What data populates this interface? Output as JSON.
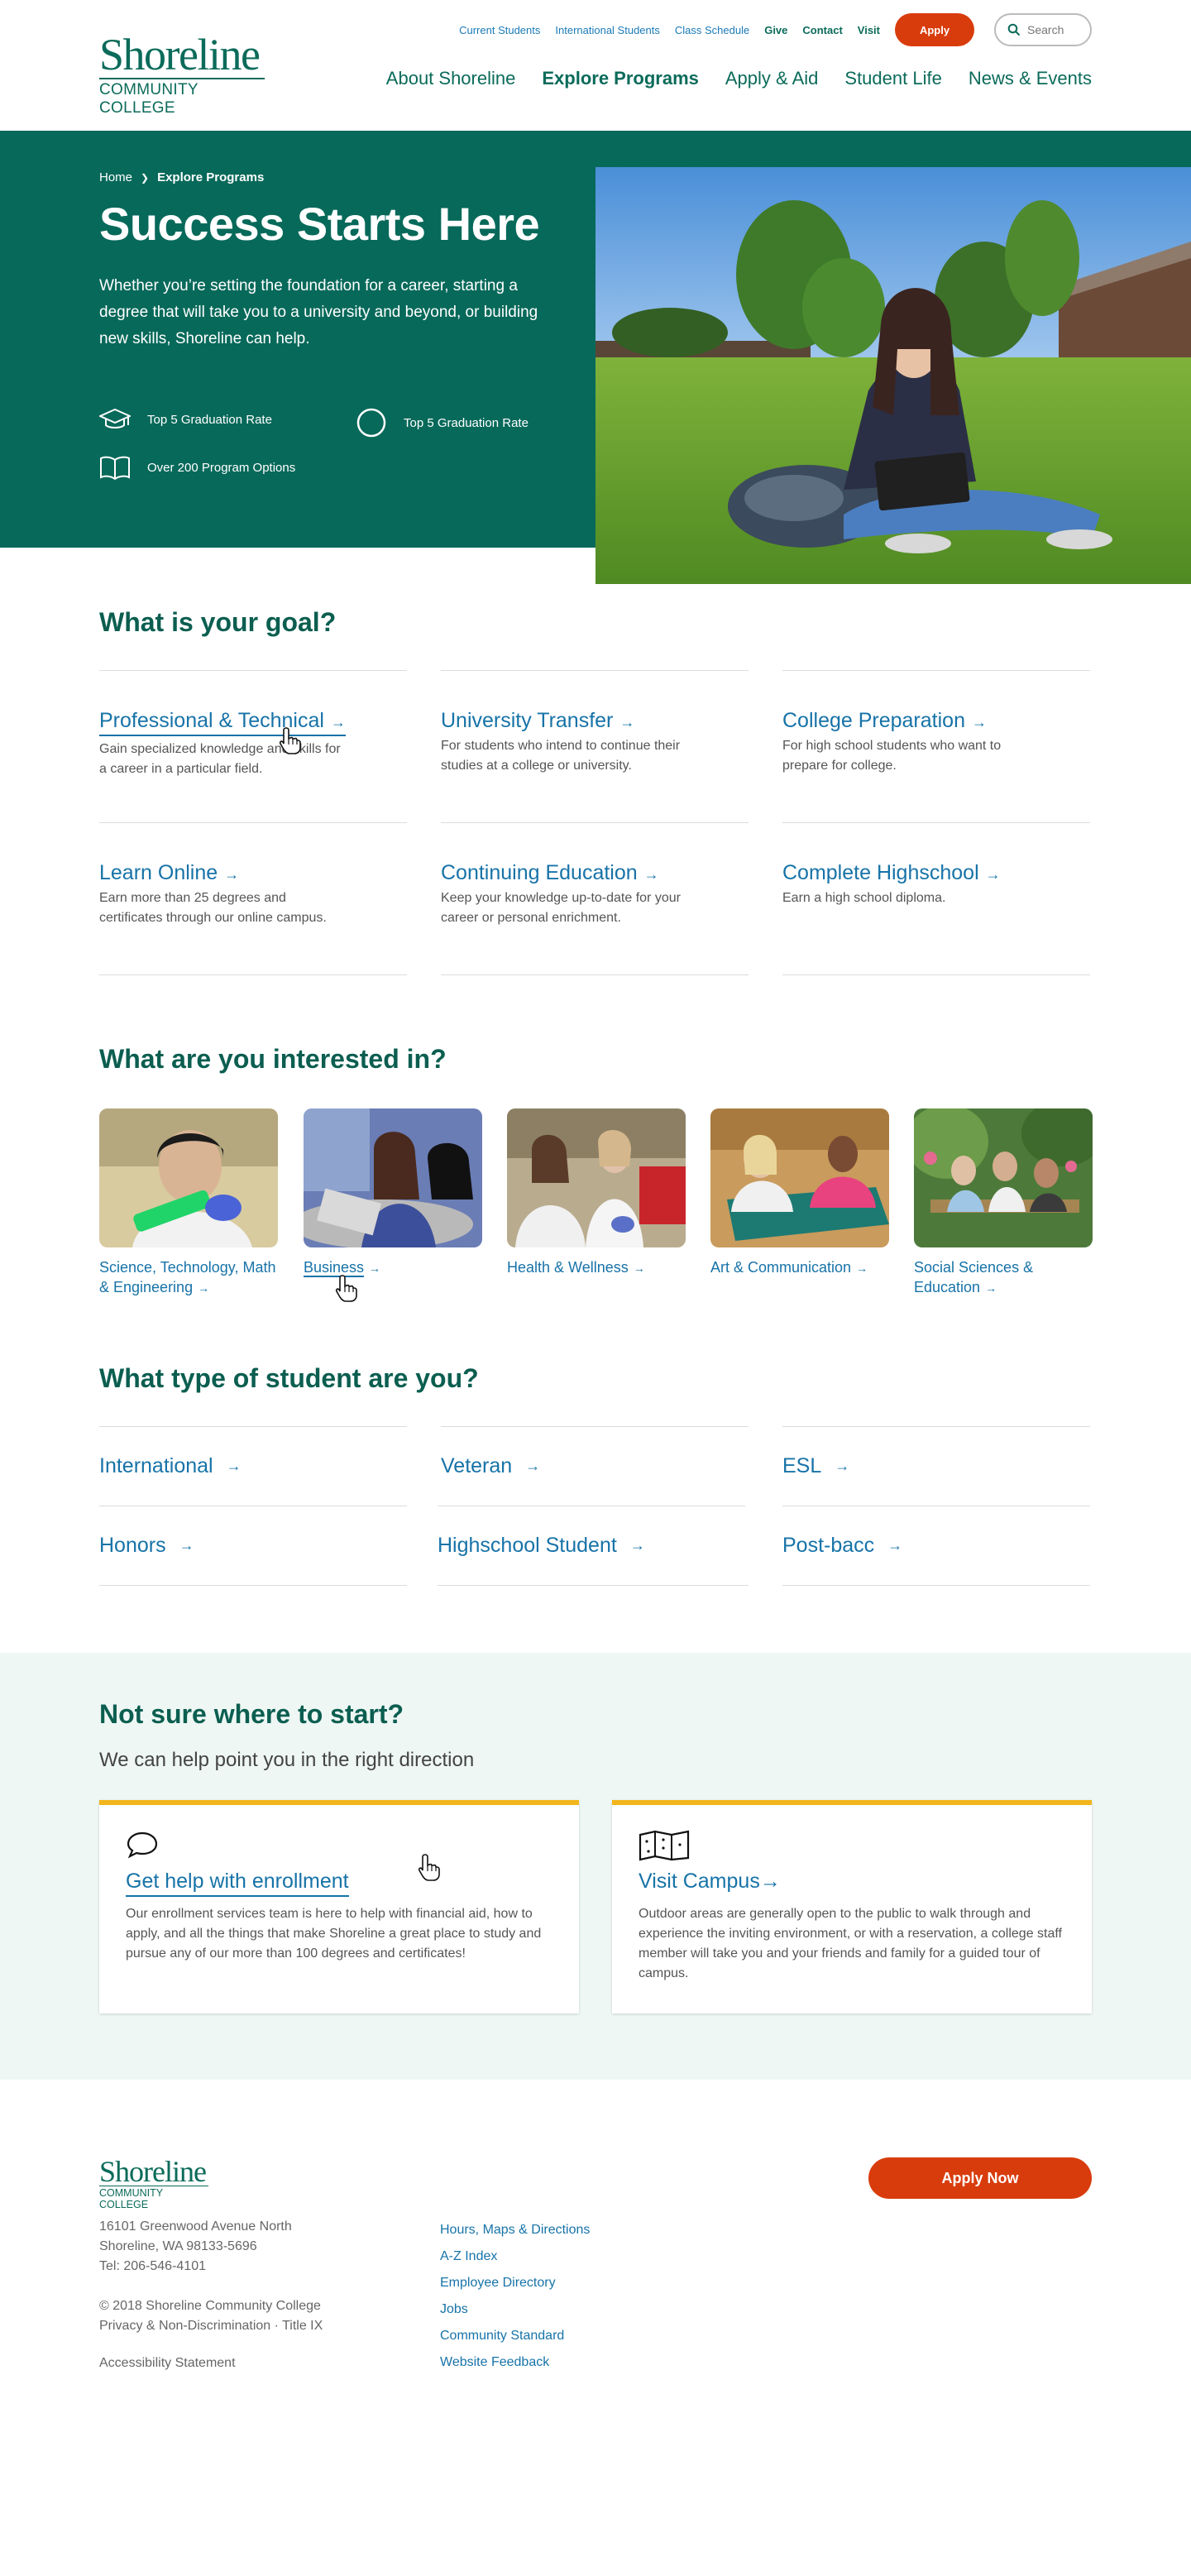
{
  "logo": {
    "name": "Shoreline",
    "subtitle": "COMMUNITY COLLEGE"
  },
  "utility_nav": {
    "links": [
      "Current Students",
      "International Students",
      "Class Schedule"
    ],
    "bold_links": [
      "Give",
      "Contact",
      "Visit"
    ],
    "apply_label": "Apply",
    "search_placeholder": "Search"
  },
  "main_nav": {
    "items": [
      "About Shoreline",
      "Explore Programs",
      "Apply & Aid",
      "Student Life",
      "News & Events"
    ],
    "active": "Explore Programs"
  },
  "hero": {
    "breadcrumb": [
      "Home",
      "Explore Programs"
    ],
    "title": "Success Starts Here",
    "intro": "Whether you’re setting the foundation for a career, starting a degree that will take you to a university and beyond, or building new skills, Shoreline can help.",
    "stats": [
      {
        "icon": "graduation-cap-icon",
        "label": "Top 5 Graduation Rate"
      },
      {
        "icon": "circle-icon",
        "label": "Top 5 Graduation Rate"
      },
      {
        "icon": "open-book-icon",
        "label": "Over 200 Program Options"
      }
    ]
  },
  "goals": {
    "title": "What is your goal?",
    "items": [
      {
        "label": "Professional & Technical",
        "desc": "Gain specialized knowledge and skills for a career in a particular field."
      },
      {
        "label": "University Transfer",
        "desc": "For students who intend to continue their studies at a college or university."
      },
      {
        "label": "College Preparation",
        "desc": "For high school students who want to prepare for college."
      },
      {
        "label": "Learn Online",
        "desc": "Earn more than 25 degrees and certificates through our online campus."
      },
      {
        "label": "Continuing Education",
        "desc": "Keep your knowledge up-to-date for your career or personal enrichment."
      },
      {
        "label": "Complete Highschool",
        "desc": "Earn a high school diploma."
      }
    ],
    "arrow": "→"
  },
  "interests": {
    "title": "What are you interested in?",
    "items": [
      {
        "label": "Science, Technology, Math & Engineering"
      },
      {
        "label": "Business"
      },
      {
        "label": "Health & Wellness"
      },
      {
        "label": "Art & Communication"
      },
      {
        "label": "Social Sciences & Education"
      }
    ]
  },
  "student_types": {
    "title": "What type of student are you?",
    "items": [
      "International",
      "Veteran",
      "ESL",
      "Honors",
      "Highschool Student",
      "Post-bacc"
    ]
  },
  "help": {
    "title": "Not sure where to start?",
    "subtitle": "We can help point you in the right direction",
    "cards": [
      {
        "icon": "speech-bubble-icon",
        "label": "Get help with enrollment",
        "desc": "Our enrollment services team is here to help with financial aid, how to apply, and all the things that make Shoreline a great place to study and pursue any of our more than 100 degrees and certificates!"
      },
      {
        "icon": "map-icon",
        "label": "Visit Campus",
        "desc": "Outdoor areas are generally open to the public to walk through and experience the inviting environment, or with a reservation, a college staff member will take you and your friends and family for a guided tour of campus."
      }
    ]
  },
  "footer": {
    "address": [
      "16101 Greenwood Avenue North",
      "Shoreline, WA 98133-5696",
      "Tel: 206-546-4101"
    ],
    "legal": [
      "© 2018 Shoreline Community College",
      "Privacy & Non-Discrimination · Title IX"
    ],
    "accessibility": "Accessibility Statement",
    "links": [
      "Hours, Maps & Directions",
      "A-Z Index",
      "Employee Directory",
      "Jobs",
      "Community Standard",
      "Website Feedback"
    ],
    "apply_now": "Apply Now"
  },
  "colors": {
    "brand_green": "#07695a",
    "link_blue": "#1773a8",
    "apply_orange": "#d93c0c",
    "card_accent": "#f2b51c",
    "help_bg": "#eef7f4"
  }
}
